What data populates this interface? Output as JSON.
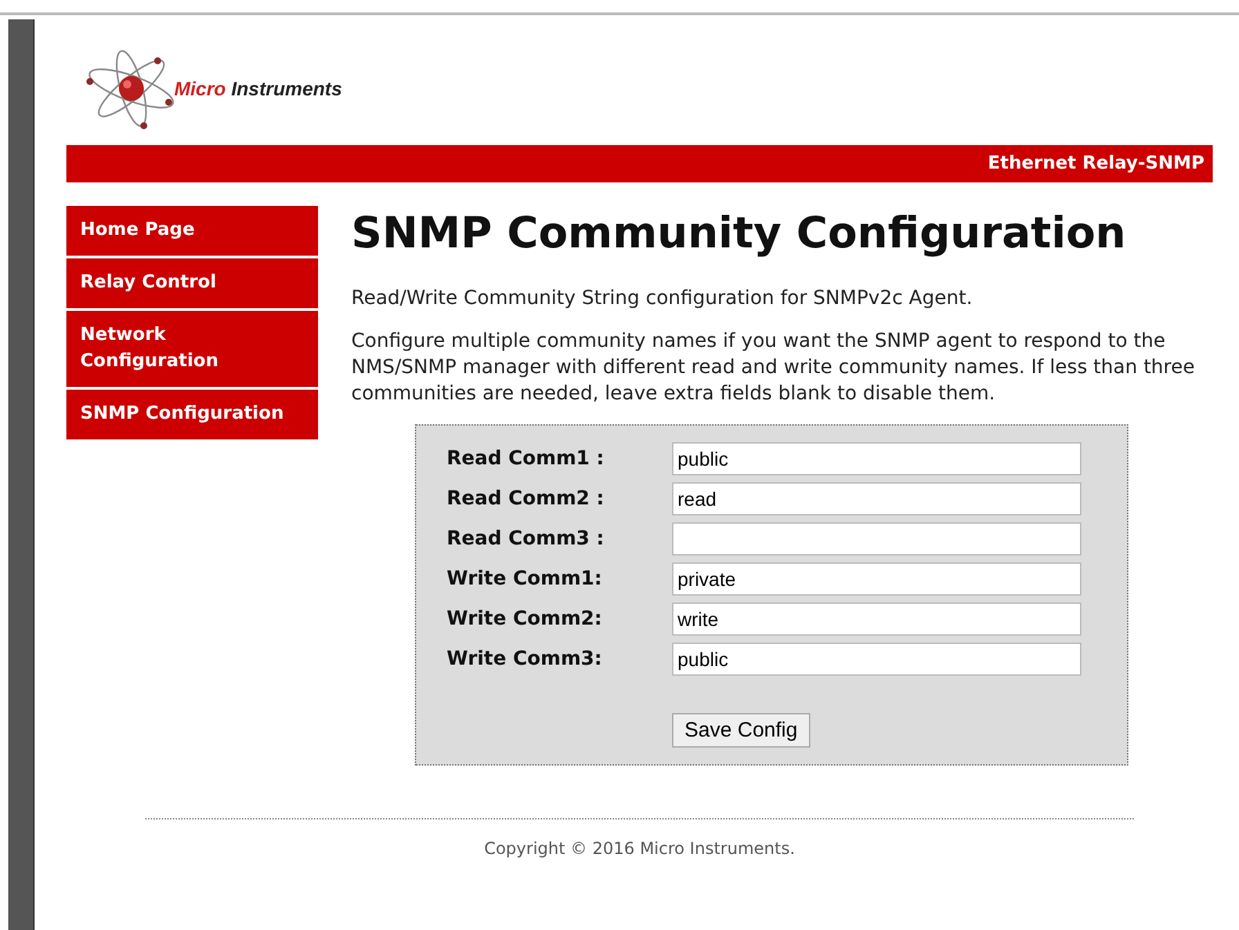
{
  "logo": {
    "accent": "Micro",
    "name": "Instruments"
  },
  "banner": {
    "title": "Ethernet Relay-SNMP"
  },
  "sidebar": {
    "items": [
      {
        "label": "Home Page"
      },
      {
        "label": "Relay Control"
      },
      {
        "label": "Network Configuration"
      },
      {
        "label": "SNMP Configuration"
      }
    ]
  },
  "page": {
    "title": "SNMP Community Configuration",
    "paragraphs": [
      "Read/Write Community String configuration for SNMPv2c Agent.",
      "Configure multiple community names if you want the SNMP agent to respond to the NMS/SNMP manager with different read and write community names. If less than three communities are needed, leave extra fields blank to disable them."
    ]
  },
  "form": {
    "fields": [
      {
        "label": "Read Comm1 :",
        "value": "public"
      },
      {
        "label": "Read Comm2 :",
        "value": "read"
      },
      {
        "label": "Read Comm3 :"
      },
      {
        "label": "Write Comm1:",
        "value": "private"
      },
      {
        "label": "Write Comm2:",
        "value": "write"
      },
      {
        "label": "Write Comm3:",
        "value": "public"
      }
    ],
    "button": "Save Config"
  },
  "footer": {
    "copyright": "Copyright © 2016 Micro Instruments."
  }
}
